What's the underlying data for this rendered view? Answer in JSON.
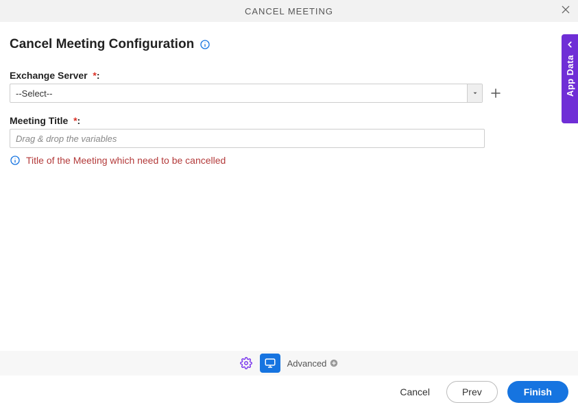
{
  "header": {
    "title": "CANCEL MEETING"
  },
  "page": {
    "title": "Cancel Meeting Configuration"
  },
  "fields": {
    "exchange_server": {
      "label": "Exchange Server",
      "required_mark": "*",
      "colon": ":",
      "value": "--Select--"
    },
    "meeting_title": {
      "label": "Meeting Title",
      "required_mark": "*",
      "colon": ":",
      "placeholder": "Drag & drop the variables",
      "hint": "Title of the Meeting which need to be cancelled"
    }
  },
  "side_tab": {
    "label": "App Data"
  },
  "toolbar": {
    "advanced_label": "Advanced"
  },
  "footer": {
    "cancel": "Cancel",
    "prev": "Prev",
    "finish": "Finish"
  }
}
